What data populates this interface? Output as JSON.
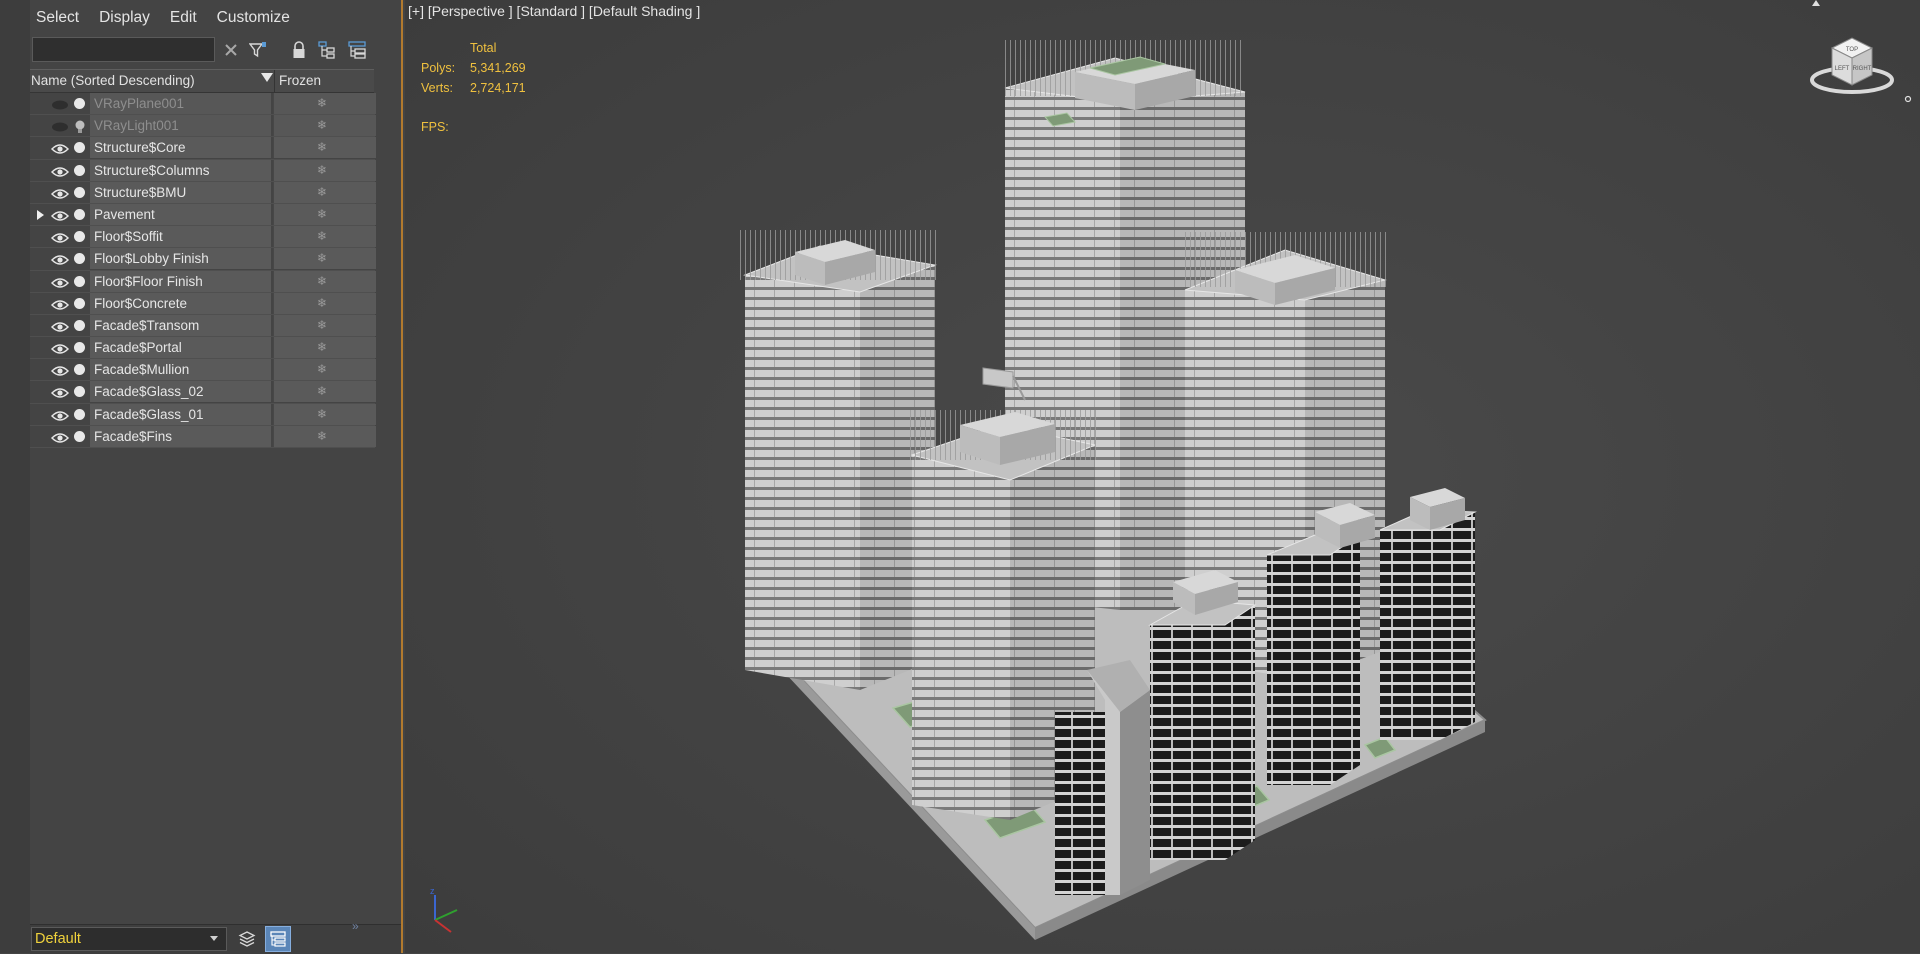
{
  "menu": [
    "Select",
    "Display",
    "Edit",
    "Customize"
  ],
  "explorer": {
    "search_value": "",
    "columns": {
      "name": "Name (Sorted Descending)",
      "frozen": "Frozen"
    },
    "rows": [
      {
        "name": "VRayPlane001",
        "type": "plane",
        "dim": true
      },
      {
        "name": "VRayLight001",
        "type": "light",
        "dim": true
      },
      {
        "name": "Structure$Core"
      },
      {
        "name": "Structure$Columns"
      },
      {
        "name": "Structure$BMU"
      },
      {
        "name": "Pavement",
        "expandable": true
      },
      {
        "name": "Floor$Soffit"
      },
      {
        "name": "Floor$Lobby Finish"
      },
      {
        "name": "Floor$Floor Finish"
      },
      {
        "name": "Floor$Concrete"
      },
      {
        "name": "Facade$Transom"
      },
      {
        "name": "Facade$Portal"
      },
      {
        "name": "Facade$Mullion"
      },
      {
        "name": "Facade$Glass_02"
      },
      {
        "name": "Facade$Glass_01"
      },
      {
        "name": "Facade$Fins"
      }
    ],
    "layer": "Default"
  },
  "viewport": {
    "label": "[+] [Perspective ] [Standard ] [Default Shading ]",
    "stats": {
      "total_label": "Total",
      "polys_label": "Polys:",
      "polys_value": "5,341,269",
      "verts_label": "Verts:",
      "verts_value": "2,724,171",
      "fps_label": "FPS:"
    },
    "viewcube": {
      "top": "TOP",
      "left": "LEFT",
      "right": "RIGHT"
    }
  },
  "colors": {
    "accent_border": "#b27a2e",
    "stats_text": "#f0c13f",
    "layer_text": "#f0d23c",
    "active_button": "#5b86b8"
  },
  "icons": [
    "clear-search-icon",
    "filter-icon",
    "lock-icon",
    "hierarchy-icon",
    "layer-hierarchy-icon",
    "layers-icon",
    "sort-icon",
    "eye-icon",
    "light-bulb-icon",
    "snowflake-icon",
    "viewcube-icon",
    "axis-tripod-icon"
  ]
}
